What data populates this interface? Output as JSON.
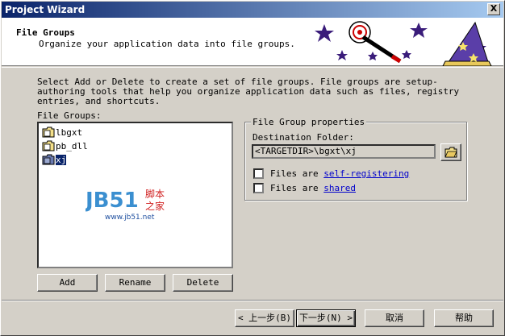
{
  "window": {
    "title": "Project Wizard",
    "close_label": "X"
  },
  "header": {
    "title": "File Groups",
    "subtitle": "Organize your application data into file groups."
  },
  "description": "Select Add or Delete to create a set of file groups.  File groups are setup-authoring tools that help you organize application data such as files, registry entries, and shortcuts.",
  "file_groups": {
    "label": "File Groups:",
    "items": [
      {
        "name": "lbgxt",
        "selected": false
      },
      {
        "name": "pb_dll",
        "selected": false
      },
      {
        "name": "xj",
        "selected": true
      }
    ],
    "buttons": {
      "add": "Add",
      "rename": "Rename",
      "delete": "Delete"
    }
  },
  "properties": {
    "title": "File Group properties",
    "dest_label": "Destination Folder:",
    "dest_value": "<TARGETDIR>\\bgxt\\xj",
    "self_registering": {
      "prefix": "Files are",
      "link": "self-registering",
      "checked": false
    },
    "shared": {
      "prefix": "Files are",
      "link": "shared",
      "checked": false
    }
  },
  "watermark": {
    "logo": "JB51",
    "cn_top": "脚本",
    "cn_bottom": "之家",
    "url": "www.jb51.net"
  },
  "navigation": {
    "back": "< 上一步(B)",
    "next": "下一步(N) >",
    "cancel": "取消",
    "help": "帮助"
  },
  "colors": {
    "titlebar": "#0a246a",
    "selection": "#0a246a",
    "link": "#0000cc",
    "face": "#d4d0c8"
  }
}
